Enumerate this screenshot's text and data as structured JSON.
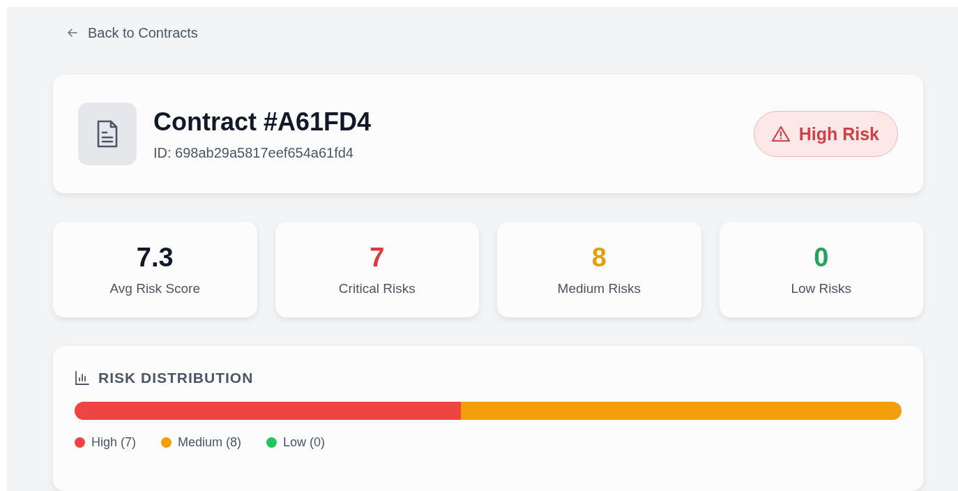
{
  "back_link": {
    "label": "Back to Contracts"
  },
  "contract": {
    "title": "Contract #A61FD4",
    "id_line": "ID: 698ab29a5817eef654a61fd4",
    "risk_badge": {
      "label": "High Risk",
      "kind": "high"
    }
  },
  "stats": [
    {
      "value": "7.3",
      "label": "Avg Risk Score",
      "color": "#111827"
    },
    {
      "value": "7",
      "label": "Critical Risks",
      "color": "#dc3b3b"
    },
    {
      "value": "8",
      "label": "Medium Risks",
      "color": "#e59e0b"
    },
    {
      "value": "0",
      "label": "Low Risks",
      "color": "#22a55a"
    }
  ],
  "distribution": {
    "title": "RISK DISTRIBUTION",
    "segments": [
      {
        "level": 0.467
      },
      {
        "level": 0.533
      }
    ],
    "legend": [
      {
        "label": "High (7)",
        "color": "#ef4444"
      },
      {
        "label": "Medium (8)",
        "color": "#f59e0b"
      },
      {
        "label": "Low (0)",
        "color": "#22c55e"
      }
    ]
  }
}
